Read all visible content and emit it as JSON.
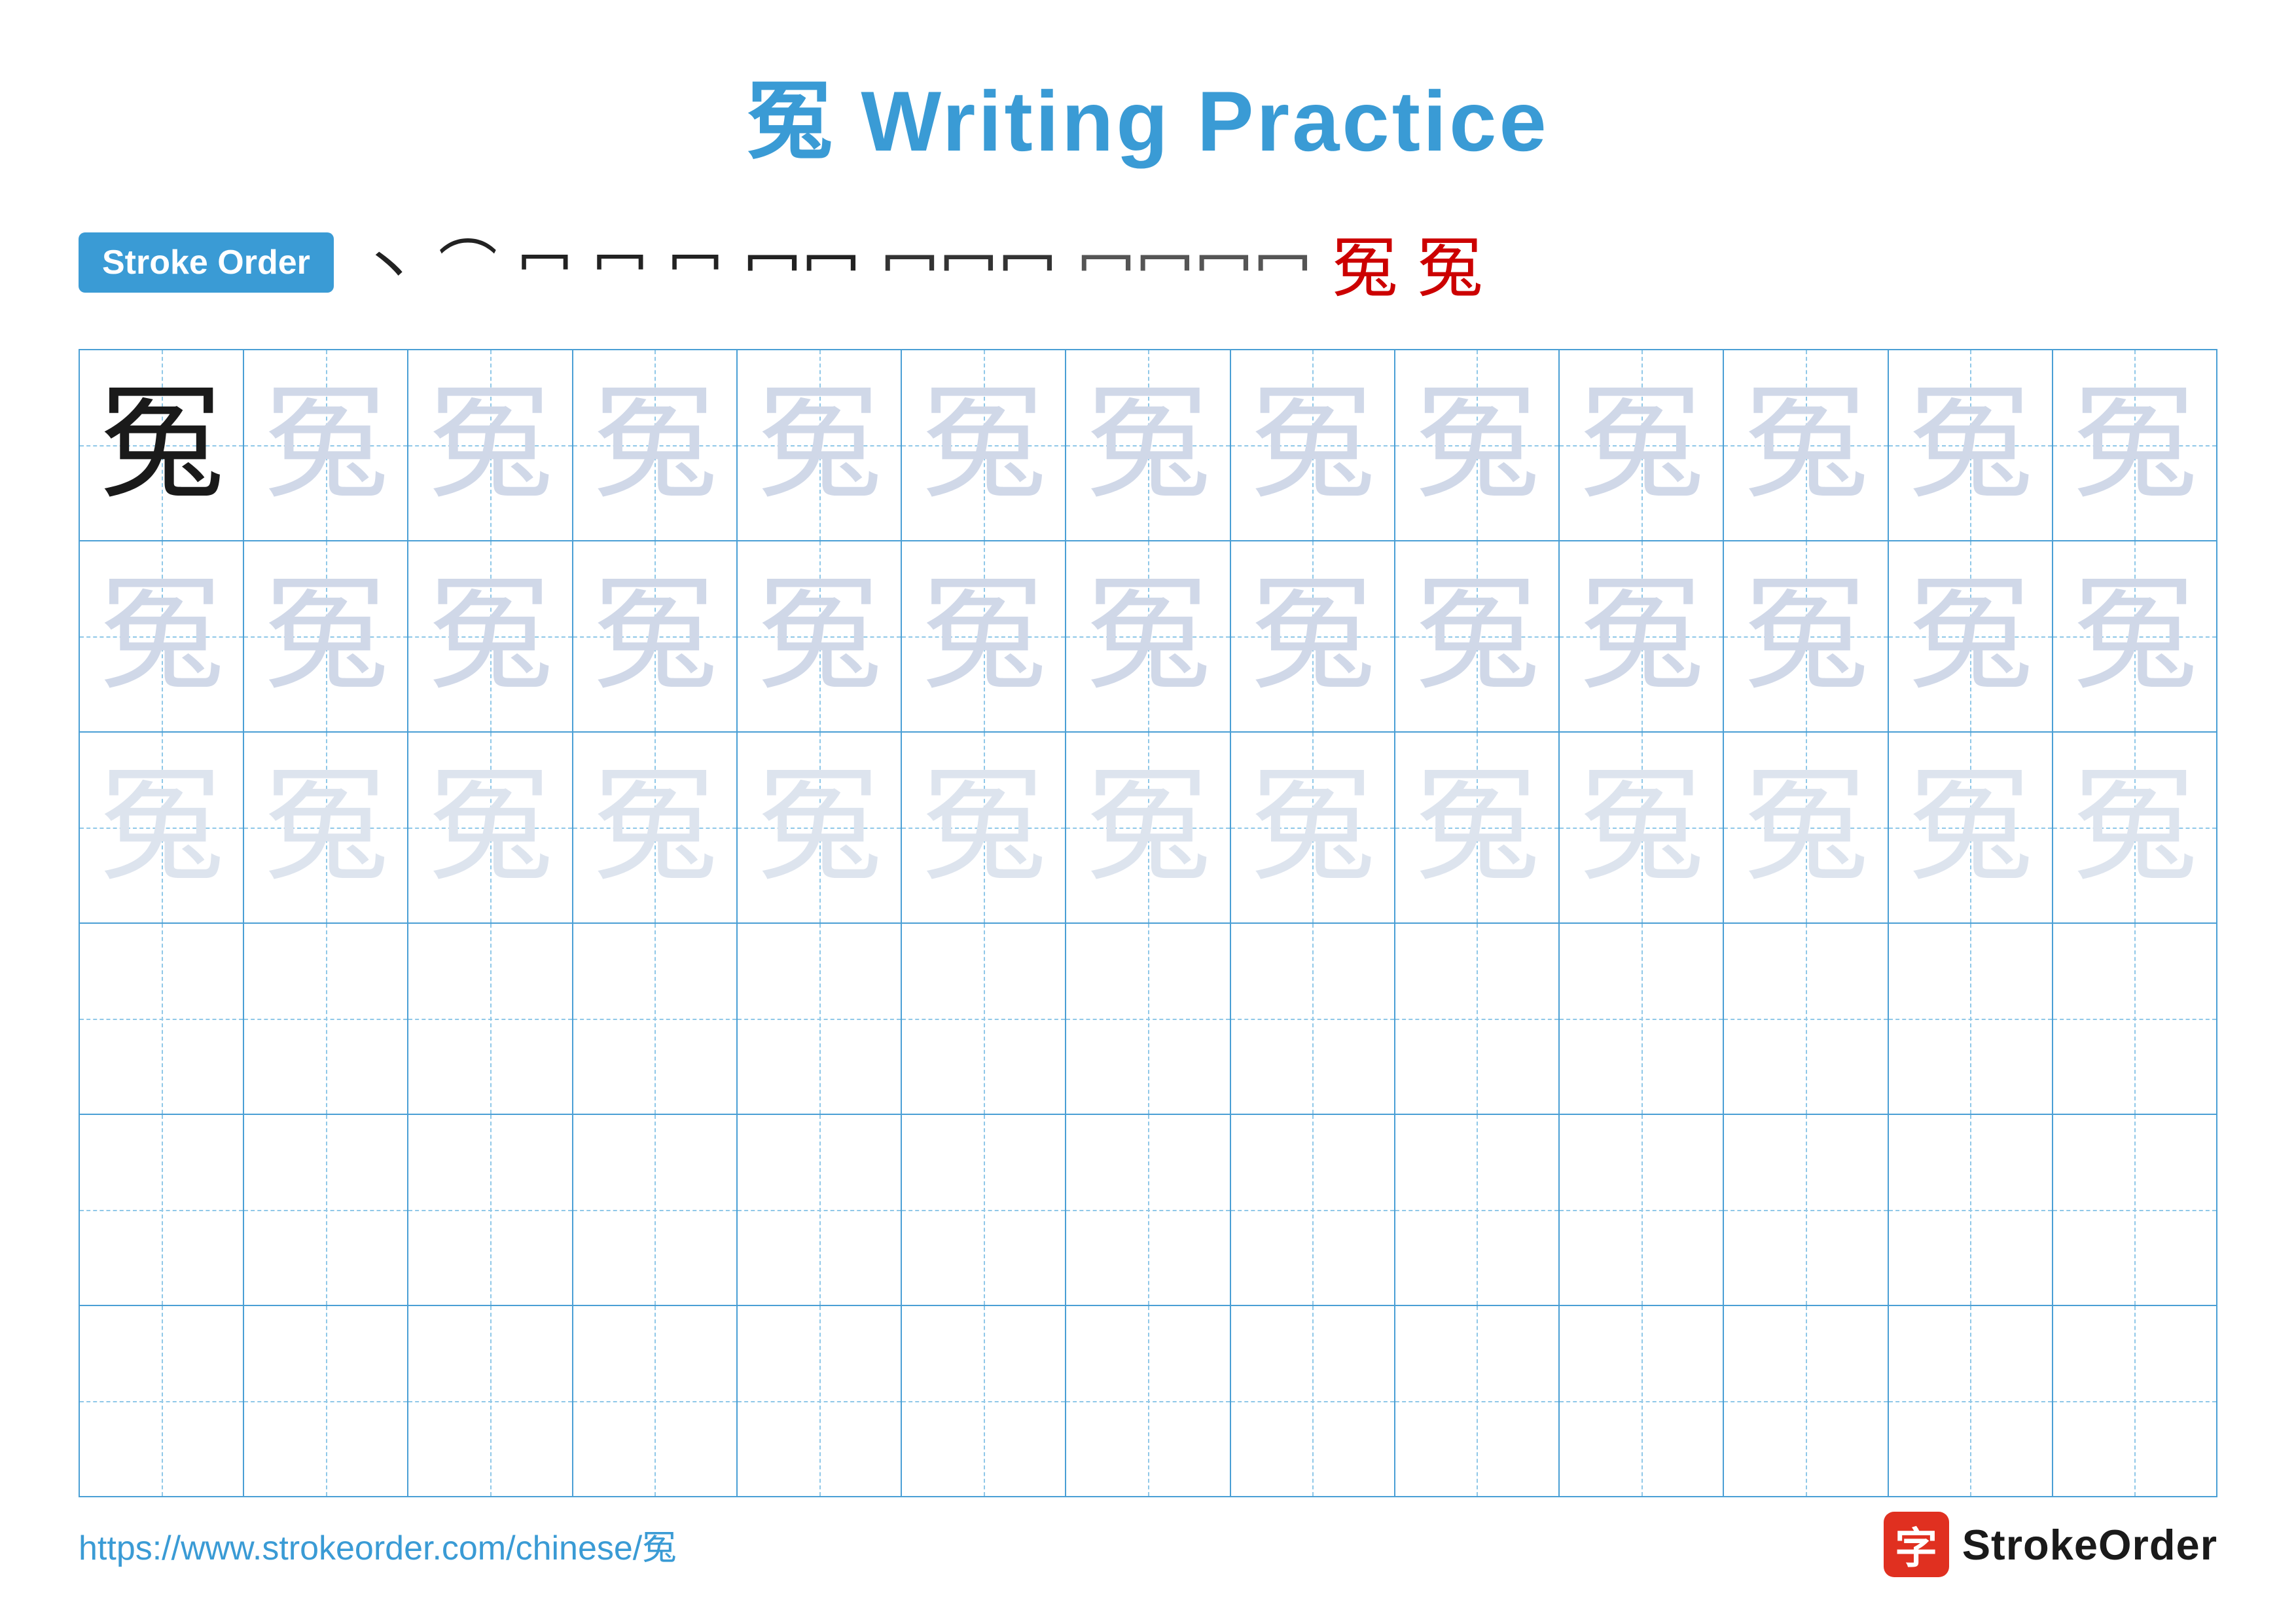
{
  "title": {
    "char": "冤",
    "label": "冤 Writing Practice"
  },
  "stroke_order": {
    "badge_label": "Stroke Order",
    "strokes": [
      "丶",
      "⺈",
      "𠃑",
      "𠃑",
      "𠃑",
      "冖",
      "冖",
      "冖",
      "冤",
      "冤"
    ]
  },
  "grid": {
    "rows": 6,
    "cols": 13,
    "char": "冤",
    "row_types": [
      "dark_then_light",
      "light",
      "lighter",
      "empty",
      "empty",
      "empty"
    ]
  },
  "footer": {
    "url": "https://www.strokeorder.com/chinese/冤",
    "logo_char": "字",
    "logo_text": "StrokeOrder"
  }
}
